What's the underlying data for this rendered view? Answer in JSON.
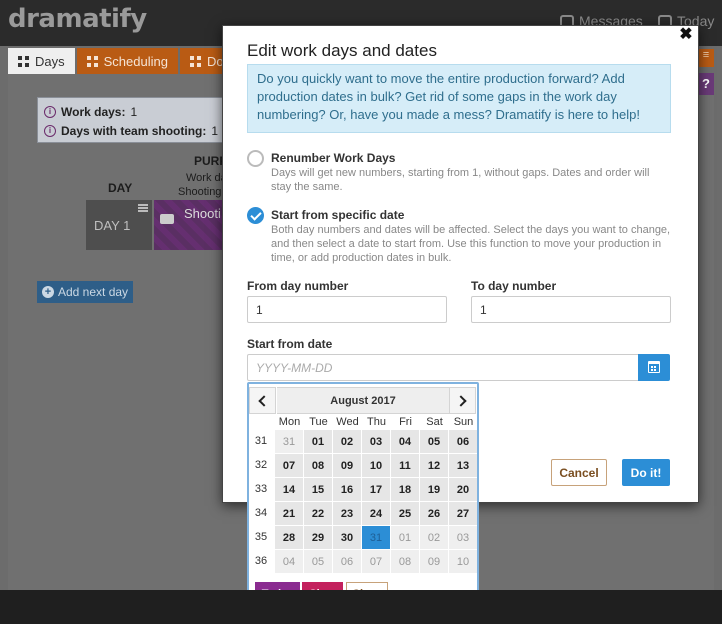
{
  "app": {
    "logo": "dramatify",
    "top_links": {
      "messages": "Messages",
      "today": "Today"
    }
  },
  "tabs": [
    {
      "label": "Days",
      "active": true
    },
    {
      "label": "Scheduling",
      "active": false
    },
    {
      "label": "Doc",
      "active": false
    }
  ],
  "info": {
    "work_days_label": "Work days:",
    "work_days_value": "1",
    "team_days_label": "Days with team shooting:",
    "team_days_value": "1"
  },
  "schedule": {
    "column_day": "DAY",
    "column_purpose": "PURP",
    "sub1": "Work da",
    "sub2": "Shooting",
    "day_label": "DAY 1",
    "shoot_label": "Shooti",
    "add_next_day": "Add next day"
  },
  "modal": {
    "title": "Edit work days and dates",
    "intro": "Do you quickly want to move the entire production forward? Add production dates in bulk? Get rid of some gaps in the work day numbering? Or, have you made a mess? Dramatify is here to help!",
    "option1": {
      "title": "Renumber Work Days",
      "desc": "Days will get new numbers, starting from 1, without gaps. Dates and order will stay the same.",
      "checked": false
    },
    "option2": {
      "title": "Start from specific date",
      "desc": "Both day numbers and dates will be affected. Select the days you want to change, and then select a date to start from. Use this function to move your production in time, or add production dates in bulk.",
      "checked": true
    },
    "from_label": "From day number",
    "from_value": "1",
    "to_label": "To day number",
    "to_value": "1",
    "start_label": "Start from date",
    "start_placeholder": "YYYY-MM-DD",
    "cancel": "Cancel",
    "do_it": "Do it!"
  },
  "datepicker": {
    "month": "August 2017",
    "weekdays": [
      "Mon",
      "Tue",
      "Wed",
      "Thu",
      "Fri",
      "Sat",
      "Sun"
    ],
    "weeks": [
      {
        "week": "31",
        "days": [
          "31",
          "01",
          "02",
          "03",
          "04",
          "05",
          "06"
        ],
        "other": [
          true,
          false,
          false,
          false,
          false,
          false,
          false
        ]
      },
      {
        "week": "32",
        "days": [
          "07",
          "08",
          "09",
          "10",
          "11",
          "12",
          "13"
        ],
        "other": [
          false,
          false,
          false,
          false,
          false,
          false,
          false
        ]
      },
      {
        "week": "33",
        "days": [
          "14",
          "15",
          "16",
          "17",
          "18",
          "19",
          "20"
        ],
        "other": [
          false,
          false,
          false,
          false,
          false,
          false,
          false
        ]
      },
      {
        "week": "34",
        "days": [
          "21",
          "22",
          "23",
          "24",
          "25",
          "26",
          "27"
        ],
        "other": [
          false,
          false,
          false,
          false,
          false,
          false,
          false
        ]
      },
      {
        "week": "35",
        "days": [
          "28",
          "29",
          "30",
          "31",
          "01",
          "02",
          "03"
        ],
        "other": [
          false,
          false,
          false,
          false,
          true,
          true,
          true
        ]
      },
      {
        "week": "36",
        "days": [
          "04",
          "05",
          "06",
          "07",
          "08",
          "09",
          "10"
        ],
        "other": [
          true,
          true,
          true,
          true,
          true,
          true,
          true
        ]
      }
    ],
    "selected": {
      "week": 4,
      "day": 3
    },
    "today_btn": "Today",
    "clear_btn": "Clear",
    "close_btn": "Close"
  },
  "colors": {
    "accent": "#2c8ed6",
    "orange_tab": "#b95b14",
    "today": "#8a2b90",
    "clear": "#c3215d"
  }
}
